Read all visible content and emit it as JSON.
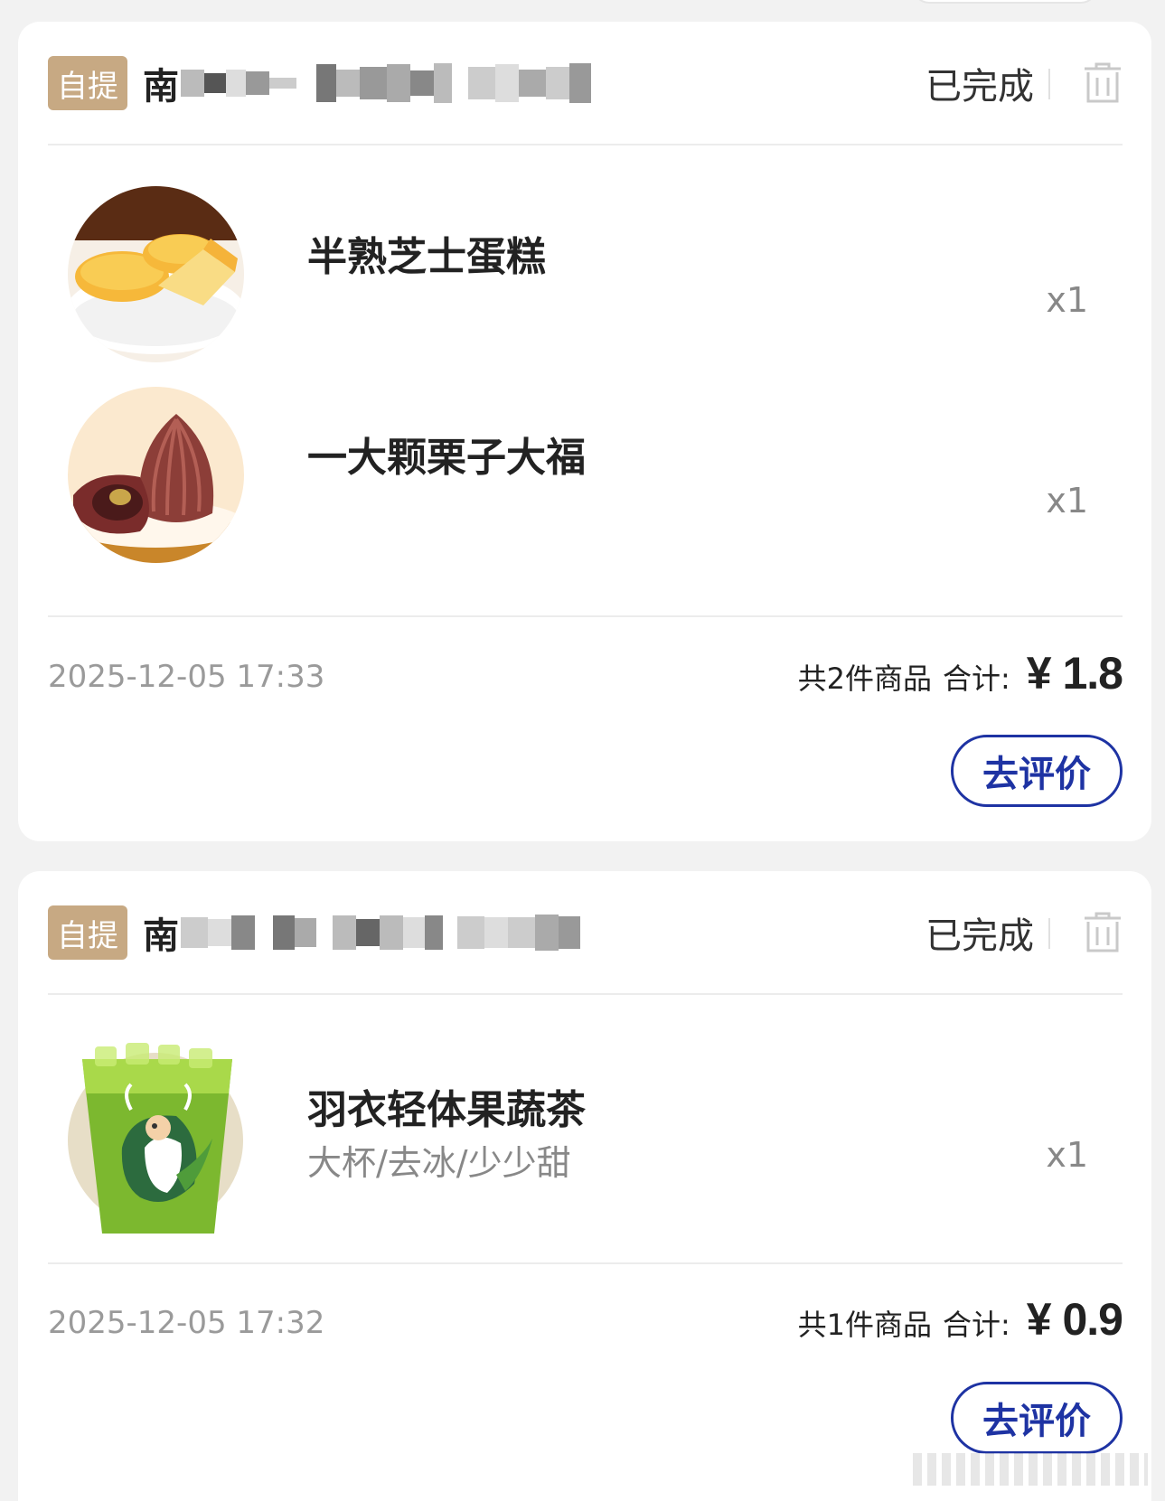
{
  "orders": [
    {
      "badge": "自提",
      "store_prefix": "南",
      "status": "已完成",
      "items": [
        {
          "name": "半熟芝士蛋糕",
          "spec": "",
          "qty": "x1",
          "image": "cheesecake"
        },
        {
          "name": "一大颗栗子大福",
          "spec": "",
          "qty": "x1",
          "image": "chestnut-daifuku"
        }
      ],
      "timestamp": "2025-12-05 17:33",
      "count_text": "共2件商品",
      "total_label": "合计:",
      "price": "¥ 1.8",
      "review_label": "去评价"
    },
    {
      "badge": "自提",
      "store_prefix": "南",
      "status": "已完成",
      "items": [
        {
          "name": "羽衣轻体果蔬茶",
          "spec": "大杯/去冰/少少甜",
          "qty": "x1",
          "image": "green-veggie-tea"
        }
      ],
      "timestamp": "2025-12-05 17:32",
      "count_text": "共1件商品",
      "total_label": "合计:",
      "price": "¥ 0.9",
      "review_label": "去评价"
    }
  ],
  "colors": {
    "badge_bg": "#c7a983",
    "review_border": "#1e33a3",
    "background": "#f2f2f2"
  },
  "icons": [
    "trash-icon"
  ]
}
